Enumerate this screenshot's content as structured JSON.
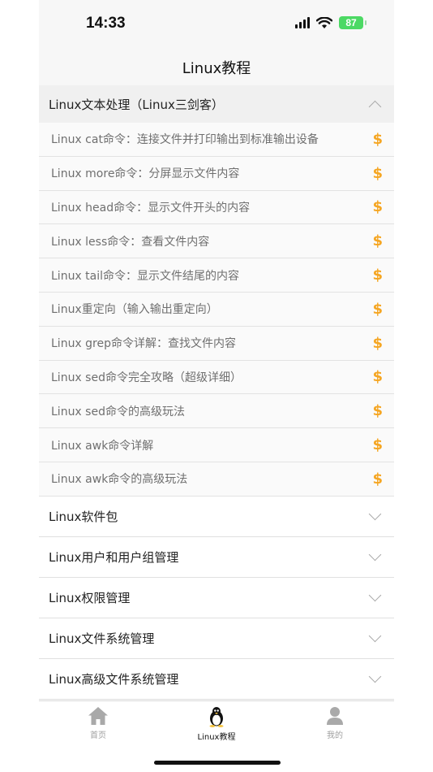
{
  "status_bar": {
    "time": "14:33",
    "battery": "87",
    "icons": [
      "cellular-signal-icon",
      "wifi-icon",
      "battery-icon"
    ]
  },
  "nav": {
    "title": "Linux教程"
  },
  "sections": [
    {
      "title": "Linux文本处理（Linux三剑客）",
      "expanded": true,
      "lessons": [
        {
          "title": "Linux cat命令：连接文件并打印输出到标准输出设备",
          "paid": true
        },
        {
          "title": "Linux more命令：分屏显示文件内容",
          "paid": true
        },
        {
          "title": "Linux head命令：显示文件开头的内容",
          "paid": true
        },
        {
          "title": "Linux less命令：查看文件内容",
          "paid": true
        },
        {
          "title": "Linux tail命令：显示文件结尾的内容",
          "paid": true
        },
        {
          "title": "Linux重定向（输入输出重定向）",
          "paid": true
        },
        {
          "title": "Linux grep命令详解：查找文件内容",
          "paid": true
        },
        {
          "title": "Linux sed命令完全攻略（超级详细）",
          "paid": true
        },
        {
          "title": "Linux sed命令的高级玩法",
          "paid": true
        },
        {
          "title": "Linux awk命令详解",
          "paid": true
        },
        {
          "title": "Linux awk命令的高级玩法",
          "paid": true
        }
      ]
    }
  ],
  "collapsed_sections": [
    "Linux软件包",
    "Linux用户和用户组管理",
    "Linux权限管理",
    "Linux文件系统管理",
    "Linux高级文件系统管理"
  ],
  "paid_symbol": "$",
  "colors": {
    "accent": "#f5a623",
    "battery": "#4cd964"
  },
  "tab_bar": {
    "tabs": [
      {
        "label": "首页",
        "icon": "home-icon",
        "active": false
      },
      {
        "label": "Linux教程",
        "icon": "penguin-icon",
        "active": true
      },
      {
        "label": "我的",
        "icon": "person-icon",
        "active": false
      }
    ]
  }
}
